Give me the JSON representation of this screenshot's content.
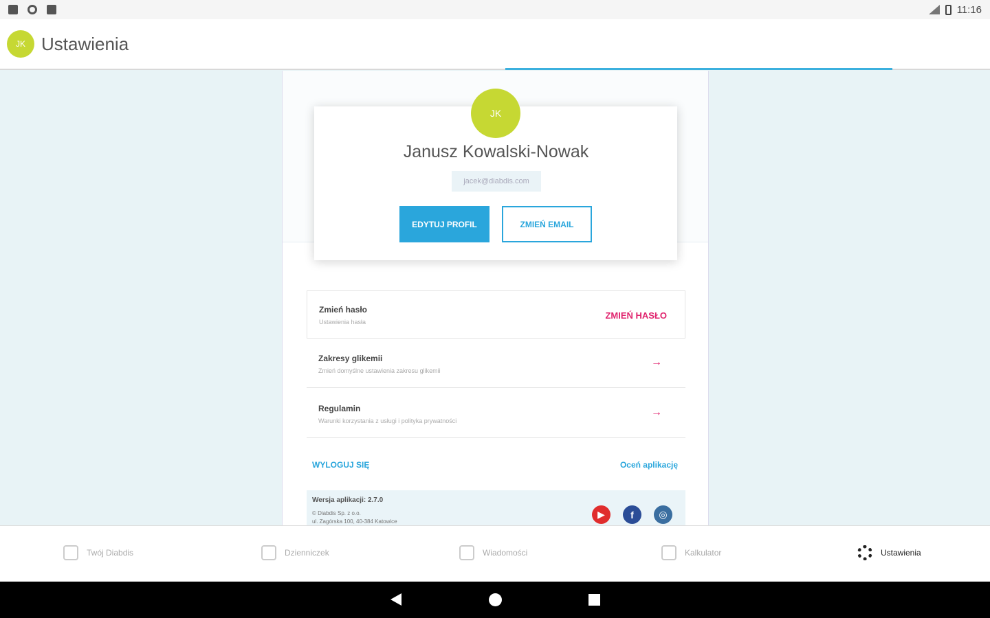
{
  "status_bar": {
    "time": "11:16"
  },
  "header": {
    "avatar_initials": "JK",
    "title": "Ustawienia"
  },
  "profile": {
    "avatar_initials": "JK",
    "name": "Janusz Kowalski-Nowak",
    "email": "jacek@diabdis.com",
    "edit_button": "EDYTUJ PROFIL",
    "change_email_button": "ZMIEŃ EMAIL"
  },
  "settings": [
    {
      "title": "Zmień hasło",
      "subtitle": "Ustawienia hasła",
      "action": "ZMIEŃ HASŁO"
    },
    {
      "title": "Zakresy glikemii",
      "subtitle": "Zmień domyślne ustawienia zakresu glikemii",
      "action": "→"
    },
    {
      "title": "Regulamin",
      "subtitle": "Warunki korzystania z usługi i polityka prywatności",
      "action": "→"
    }
  ],
  "links": {
    "logout": "WYLOGUJ SIĘ",
    "rate": "Oceń aplikację"
  },
  "footer": {
    "version": "Wersja aplikacji: 2.7.0",
    "copyright": "© Diabdis Sp. z o.o.",
    "address": "ul. Zagórska 100, 40-384 Katowice",
    "social": [
      "youtube-icon",
      "facebook-icon",
      "instagram-icon"
    ]
  },
  "bottom_nav": [
    {
      "label": "Twój Diabdis",
      "icon": "diabdis-icon"
    },
    {
      "label": "Dzienniczek",
      "icon": "journal-icon"
    },
    {
      "label": "Wiadomości",
      "icon": "messages-icon"
    },
    {
      "label": "Kalkulator",
      "icon": "calculator-icon"
    },
    {
      "label": "Ustawienia",
      "icon": "gear-icon"
    }
  ],
  "colors": {
    "accent": "#2aa6dc",
    "pink": "#e0246e",
    "avatar": "#c6d833",
    "background": "#e8f3f6"
  }
}
